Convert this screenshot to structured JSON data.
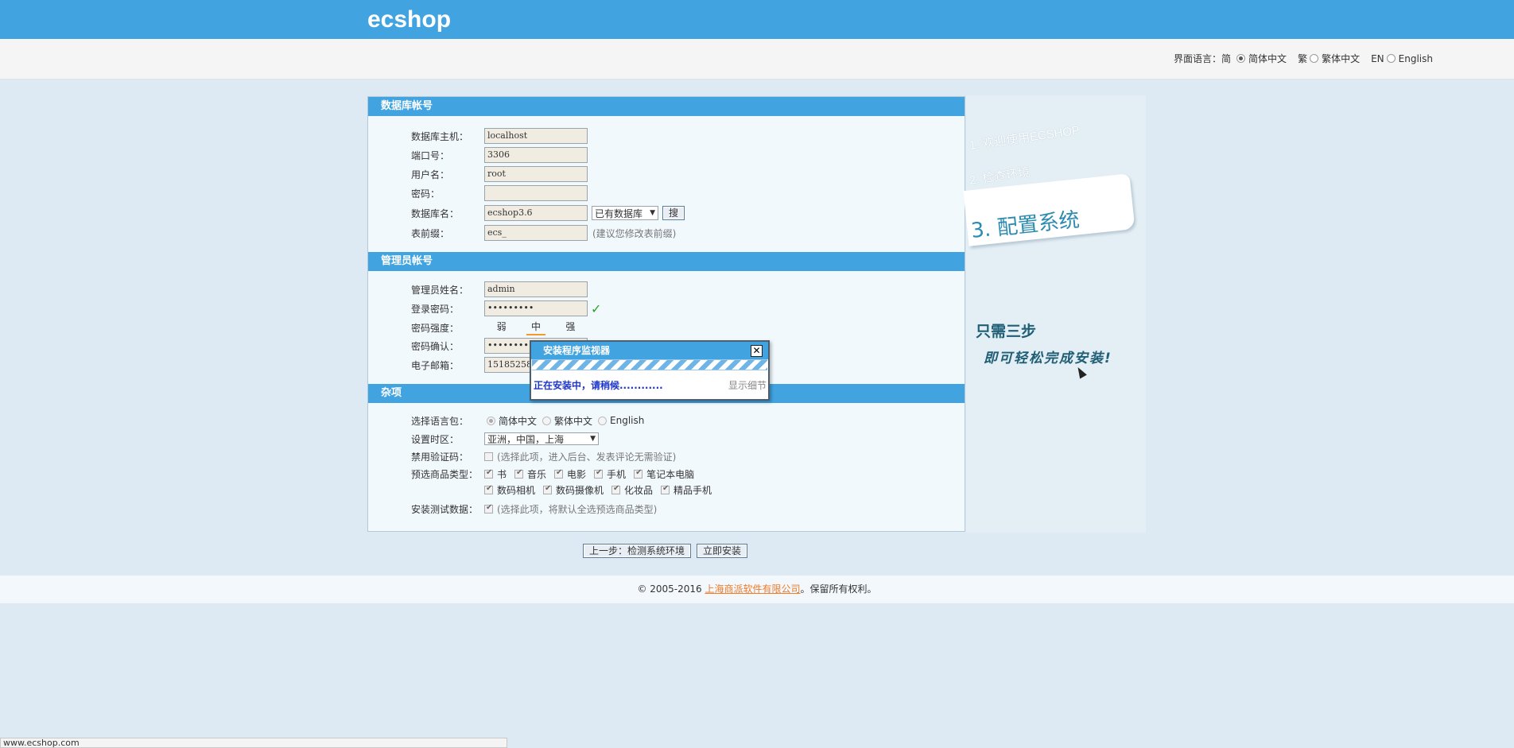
{
  "header": {
    "logo": "ecshop"
  },
  "language_bar": {
    "label": "界面语言：简",
    "options": [
      {
        "label": "简体中文",
        "prefix": "",
        "selected": true
      },
      {
        "label": "繁体中文",
        "prefix": "繁",
        "selected": false
      },
      {
        "label": "English",
        "prefix": "EN",
        "selected": false
      }
    ]
  },
  "db_section": {
    "title": "数据库帐号",
    "host_label": "数据库主机：",
    "host_value": "localhost",
    "port_label": "端口号：",
    "port_value": "3306",
    "user_label": "用户名：",
    "user_value": "root",
    "password_label": "密码：",
    "password_value": "",
    "dbname_label": "数据库名：",
    "dbname_value": "ecshop3.6",
    "existing_db_select": "已有数据库",
    "search_button": "搜",
    "prefix_label": "表前缀：",
    "prefix_value": "ecs_",
    "prefix_hint": "(建议您修改表前缀)"
  },
  "admin_section": {
    "title": "管理员帐号",
    "name_label": "管理员姓名：",
    "name_value": "admin",
    "password_label": "登录密码：",
    "password_value": "•••••••••",
    "strength_label": "密码强度：",
    "strength": [
      "弱",
      "中",
      "强"
    ],
    "confirm_label": "密码确认：",
    "confirm_value": "•••••••••",
    "email_label": "电子邮箱：",
    "email_value": "151852586"
  },
  "misc_section": {
    "title": "杂项",
    "langpack_label": "选择语言包：",
    "langpack_options": [
      {
        "label": "简体中文",
        "selected": true
      },
      {
        "label": "繁体中文",
        "selected": false
      },
      {
        "label": "English",
        "selected": false
      }
    ],
    "timezone_label": "设置时区：",
    "timezone_value": "亚洲，中国，上海",
    "captcha_label": "禁用验证码：",
    "captcha_hint": "(选择此项，进入后台、发表评论无需验证)",
    "goods_type_label": "预选商品类型：",
    "goods_types_row1": [
      "书",
      "音乐",
      "电影",
      "手机",
      "笔记本电脑"
    ],
    "goods_types_row2": [
      "数码相机",
      "数码摄像机",
      "化妆品",
      "精品手机"
    ],
    "test_data_label": "安装测试数据：",
    "test_data_hint": "(选择此项，将默认全选预选商品类型)"
  },
  "steps": {
    "step1": "1. 欢迎使用ECSHOP",
    "step2": "2. 检查环境",
    "step3": "3. 配置系统",
    "tagline1": "只需三步",
    "tagline2": "即可轻松完成安装!"
  },
  "actions": {
    "prev_button": "上一步：检测系统环境",
    "install_button": "立即安装"
  },
  "footer": {
    "prefix": "© 2005-2016 ",
    "company_link": "上海商派软件有限公司",
    "suffix": "。保留所有权利。"
  },
  "dialog": {
    "title": "安装程序监视器",
    "close": "✕",
    "message": "正在安装中，请稍候............",
    "details": "显示细节"
  },
  "status_bar": {
    "url": "www.ecshop.com"
  }
}
